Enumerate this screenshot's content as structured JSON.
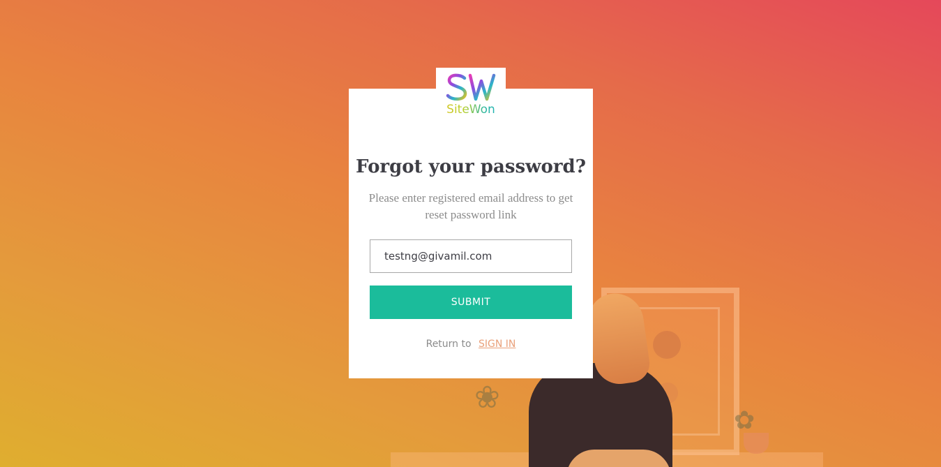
{
  "brand": {
    "logo_letters": "SW",
    "name": "SiteWon"
  },
  "form": {
    "title": "Forgot your password?",
    "subtitle": "Please enter registered email address to get reset password link",
    "email_value": "testng@givamil.com",
    "submit_label": "SUBMIT",
    "return_text": "Return to",
    "signin_label": "SIGN IN"
  },
  "colors": {
    "accent": "#1bbc9b",
    "link": "#e9a07a",
    "gradient_start": "#dfae2f",
    "gradient_end": "#e5485a"
  }
}
